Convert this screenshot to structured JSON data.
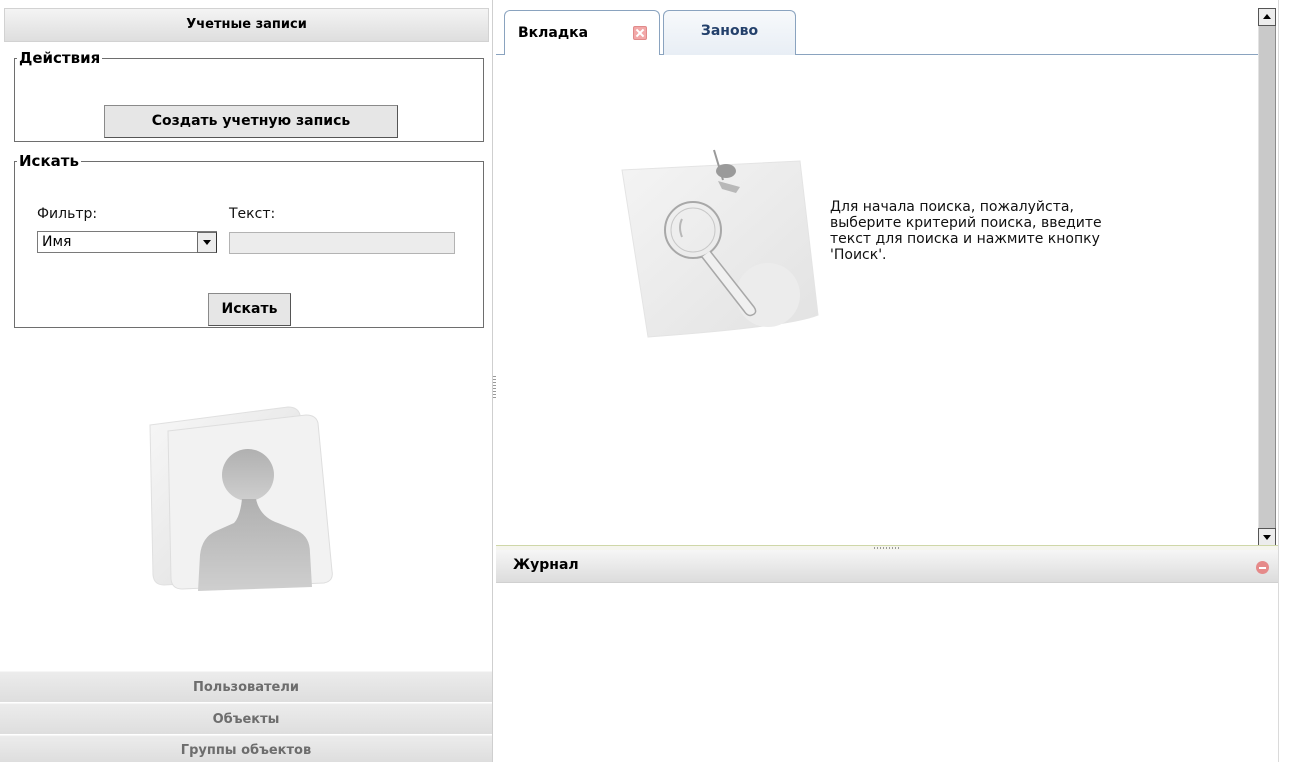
{
  "left_panel": {
    "header": "Учетные записи",
    "actions": {
      "legend": "Действия",
      "create_button": "Создать учетную запись"
    },
    "search": {
      "legend": "Искать",
      "filter_label": "Фильтр:",
      "filter_value": "Имя",
      "text_label": "Текст:",
      "text_value": "",
      "search_button": "Искать"
    },
    "accordion": [
      {
        "label": "Пользователи"
      },
      {
        "label": "Объекты"
      },
      {
        "label": "Группы объектов"
      }
    ]
  },
  "tabs": [
    {
      "label": "Вкладка",
      "active": true,
      "closable": true
    },
    {
      "label": "Заново",
      "active": false,
      "closable": false
    }
  ],
  "content": {
    "hint": "Для начала поиска, пожалуйста, выберите критерий поиска, введите текст для поиска и нажмите кнопку 'Поиск'."
  },
  "log": {
    "title": "Журнал"
  },
  "colors": {
    "tab_border": "#8aa3bf",
    "tab_inactive_text": "#23406b",
    "close_icon": "#f2a8a8",
    "minimize_icon": "#e58a8a"
  }
}
